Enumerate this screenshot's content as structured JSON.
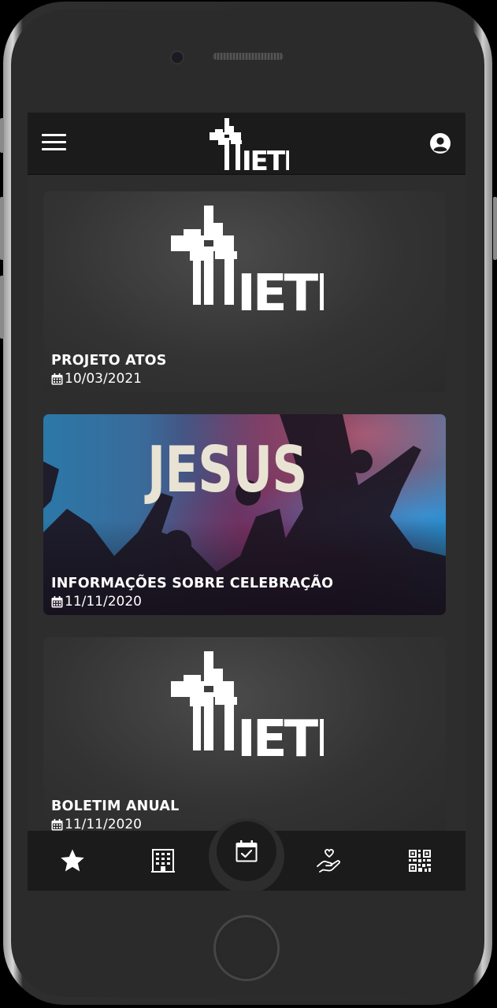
{
  "app": {
    "logo_text": "IETD",
    "accent_color": "#ffffff",
    "bar_color": "#1b1b1b"
  },
  "header": {
    "menu_icon": "menu-icon",
    "profile_icon": "user-circle-icon"
  },
  "posts": [
    {
      "title": "PROJETO ATOS",
      "date": "10/03/2021",
      "image": "ietd-logo"
    },
    {
      "title": "INFORMAÇÕES SOBRE CELEBRAÇÃO",
      "date": "11/11/2020",
      "image": "jesus-worship-photo",
      "image_text": "JESUS"
    },
    {
      "title": "BOLETIM ANUAL",
      "date": "11/11/2020",
      "image": "ietd-logo"
    }
  ],
  "bottom_nav": [
    {
      "icon": "star-icon",
      "active": false
    },
    {
      "icon": "building-icon",
      "active": false
    },
    {
      "icon": "calendar-check-icon",
      "active": true
    },
    {
      "icon": "hand-heart-icon",
      "active": false
    },
    {
      "icon": "qr-code-icon",
      "active": false
    }
  ]
}
